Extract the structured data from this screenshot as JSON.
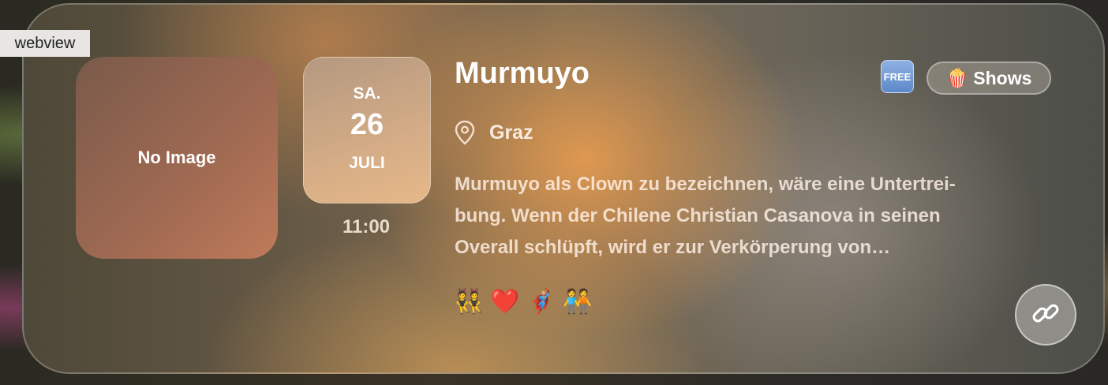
{
  "webview_label": "webview",
  "card": {
    "image_placeholder": "No Image",
    "date": {
      "weekday": "SA.",
      "day": "26",
      "month": "JULI"
    },
    "time": "11:00",
    "title": "Murmuyo",
    "free_badge": "FREE",
    "category": {
      "icon": "🍿",
      "label": "Shows"
    },
    "location": "Graz",
    "description_lines": [
      "Murmuyo als Clown zu bezeichnen, wäre eine Untertrei-",
      "bung. Wenn der Chilene Christian Casanova in seinen",
      "Overall schlüpft, wird er zur Verkörperung von…"
    ],
    "tags": [
      "👯",
      "❤️",
      "🦸🏼‍♀️",
      "🧑‍🤝‍🧑"
    ],
    "colors": {
      "accent_free": "#6b95d4",
      "card_tint": "#e0a060"
    }
  }
}
